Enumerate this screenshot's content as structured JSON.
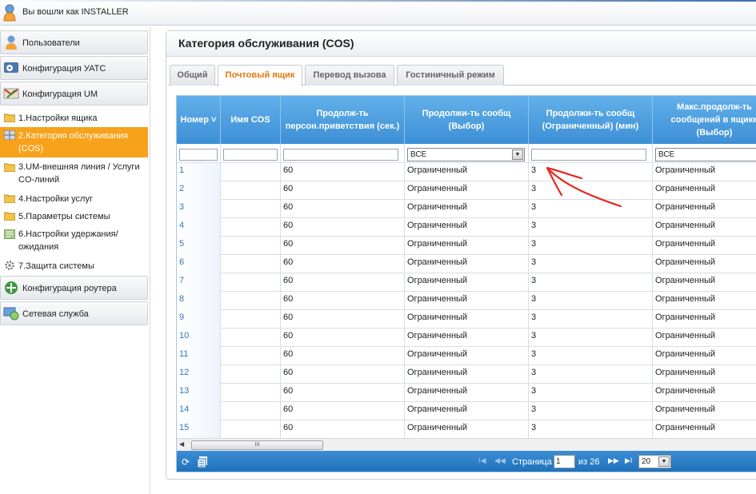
{
  "header": {
    "login_text": "Вы вошли как INSTALLER"
  },
  "sidebar": {
    "sections": [
      {
        "label": "Пользователи",
        "icon": "user-icon"
      },
      {
        "label": "Конфигурация УАТС",
        "icon": "pbx-config-icon"
      },
      {
        "label": "Конфигурация UM",
        "icon": "um-config-icon"
      },
      {
        "label": "Конфигурация роутера",
        "icon": "router-icon"
      },
      {
        "label": "Сетевая служба",
        "icon": "network-icon"
      }
    ],
    "items": [
      {
        "label": "1.Настройки ящика",
        "icon": "folder-icon"
      },
      {
        "label": "2.Категория обслуживания (COS)",
        "icon": "grid-icon",
        "active": true
      },
      {
        "label": "3.UM-внешняя линия / Услуги CO-линий",
        "icon": "folder-icon"
      },
      {
        "label": "4.Настройки услуг",
        "icon": "folder-icon"
      },
      {
        "label": "5.Параметры системы",
        "icon": "folder-icon"
      },
      {
        "label": "6.Настройки удержания/ожидания",
        "icon": "hold-icon"
      },
      {
        "label": "7.Защита системы",
        "icon": "gear-icon"
      }
    ]
  },
  "main": {
    "title": "Категория обслуживания (COS)",
    "tabs": [
      {
        "label": "Общий",
        "active": false
      },
      {
        "label": "Почтовый ящик",
        "active": true
      },
      {
        "label": "Перевод вызова",
        "active": false
      },
      {
        "label": "Гостиничный режим",
        "active": false
      }
    ]
  },
  "grid": {
    "columns": [
      "Номер ˅",
      "Имя COS",
      "Продолж-ть персон.приветствия (сек.)",
      "Продолжи-ть сообщ (Выбор)",
      "Продолжи-ть сообщ (Ограниченный) (мин)",
      "Макс.продолж-ть сообщений в ящике (Выбор)"
    ],
    "filter_select_1": "ВСЕ",
    "filter_select_2": "ВСЕ",
    "rows": [
      [
        "1",
        "",
        "60",
        "Ограниченный",
        "3",
        "Ограниченный"
      ],
      [
        "2",
        "",
        "60",
        "Ограниченный",
        "3",
        "Ограниченный"
      ],
      [
        "3",
        "",
        "60",
        "Ограниченный",
        "3",
        "Ограниченный"
      ],
      [
        "4",
        "",
        "60",
        "Ограниченный",
        "3",
        "Ограниченный"
      ],
      [
        "5",
        "",
        "60",
        "Ограниченный",
        "3",
        "Ограниченный"
      ],
      [
        "6",
        "",
        "60",
        "Ограниченный",
        "3",
        "Ограниченный"
      ],
      [
        "7",
        "",
        "60",
        "Ограниченный",
        "3",
        "Ограниченный"
      ],
      [
        "8",
        "",
        "60",
        "Ограниченный",
        "3",
        "Ограниченный"
      ],
      [
        "9",
        "",
        "60",
        "Ограниченный",
        "3",
        "Ограниченный"
      ],
      [
        "10",
        "",
        "60",
        "Ограниченный",
        "3",
        "Ограниченный"
      ],
      [
        "11",
        "",
        "60",
        "Ограниченный",
        "3",
        "Ограниченный"
      ],
      [
        "12",
        "",
        "60",
        "Ограниченный",
        "3",
        "Ограниченный"
      ],
      [
        "13",
        "",
        "60",
        "Ограниченный",
        "3",
        "Ограниченный"
      ],
      [
        "14",
        "",
        "60",
        "Ограниченный",
        "3",
        "Ограниченный"
      ],
      [
        "15",
        "",
        "60",
        "Ограниченный",
        "3",
        "Ограниченный"
      ]
    ],
    "scroll_grip": "III"
  },
  "pager": {
    "page_label": "Страница",
    "page_value": "1",
    "of_label": "из 26",
    "page_size": "20",
    "first": "I◀",
    "prev": "◀◀",
    "next": "▶▶",
    "last": "▶I"
  },
  "colors": {
    "accent": "#f7a21b",
    "header_blue": "#3d8fd6",
    "annotation_red": "#e8281e"
  }
}
